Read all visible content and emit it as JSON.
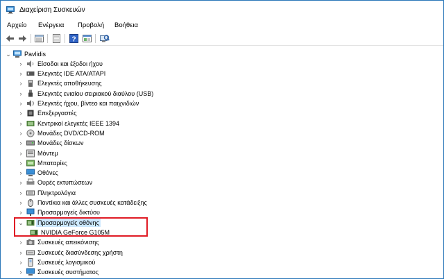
{
  "window": {
    "title": "Διαχείριση Συσκευών"
  },
  "menu": [
    "Αρχείο",
    "Ενέργεια",
    "Προβολή",
    "Βοήθεια"
  ],
  "toolbar": [
    "back-arrow-icon",
    "forward-arrow-icon",
    "properties-icon",
    "update-driver-icon",
    "help-icon",
    "view-icon",
    "scan-hardware-icon"
  ],
  "tree": {
    "root": "Pavlidis",
    "categories": [
      {
        "label": "Είσοδοι και έξοδοι ήχου",
        "icon": "speaker-icon"
      },
      {
        "label": "Ελεγκτές IDE ATA/ATAPI",
        "icon": "ide-controller-icon"
      },
      {
        "label": "Ελεγκτές αποθήκευσης",
        "icon": "storage-controller-icon"
      },
      {
        "label": "Ελεγκτές ενιαίου σειριακού διαύλου (USB)",
        "icon": "usb-icon"
      },
      {
        "label": "Ελεγκτές ήχου, βίντεο και παιχνιδιών",
        "icon": "sound-video-icon"
      },
      {
        "label": "Επεξεργαστές",
        "icon": "processor-icon"
      },
      {
        "label": "Κεντρικοί ελεγκτές IEEE 1394",
        "icon": "ieee1394-icon"
      },
      {
        "label": "Μονάδες DVD/CD-ROM",
        "icon": "dvd-drive-icon"
      },
      {
        "label": "Μονάδες δίσκων",
        "icon": "disk-drive-icon"
      },
      {
        "label": "Μόντεμ",
        "icon": "modem-icon"
      },
      {
        "label": "Μπαταρίες",
        "icon": "battery-icon"
      },
      {
        "label": "Οθόνες",
        "icon": "monitor-icon"
      },
      {
        "label": "Ουρές εκτυπώσεων",
        "icon": "print-queue-icon"
      },
      {
        "label": "Πληκτρολόγια",
        "icon": "keyboard-icon"
      },
      {
        "label": "Ποντίκια και άλλες συσκευές κατάδειξης",
        "icon": "mouse-icon"
      },
      {
        "label": "Προσαρμογείς δικτύου",
        "icon": "network-adapter-icon"
      },
      {
        "label": "Προσαρμογείς οθόνης",
        "icon": "display-adapter-icon",
        "expanded": true
      },
      {
        "label": "NVIDIA GeForce G105M",
        "icon": "display-adapter-icon",
        "child": true
      },
      {
        "label": "Συσκευές απεικόνισης",
        "icon": "imaging-device-icon"
      },
      {
        "label": "Συσκευές διασύνδεσης χρήστη",
        "icon": "hid-icon"
      },
      {
        "label": "Συσκευές λογισμικού",
        "icon": "software-device-icon"
      },
      {
        "label": "Συσκευές συστήματος",
        "icon": "system-device-icon"
      }
    ]
  },
  "colors": {
    "selected_bg": "#cce8ff",
    "highlight_border": "#e01b24",
    "window_border": "#2b77b9"
  }
}
